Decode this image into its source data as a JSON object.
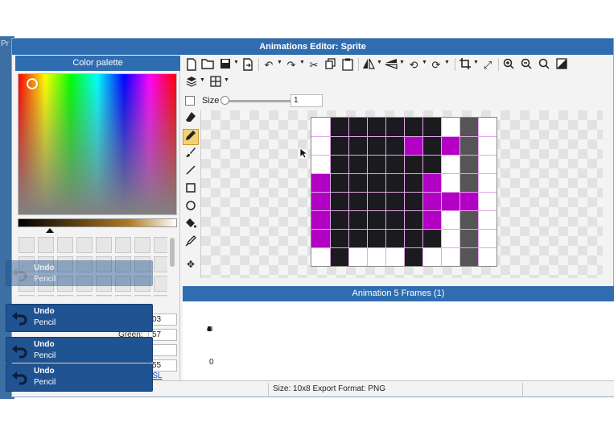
{
  "background_app": {
    "label": "Pr"
  },
  "window": {
    "title": "Animations Editor: Sprite"
  },
  "palette": {
    "title": "Color palette",
    "fields": {
      "r": "03",
      "g": "57",
      "b": "",
      "a": "55"
    },
    "green_label": "Green:",
    "mode_separator": "-",
    "mode_link": "HSL"
  },
  "toasts": [
    {
      "title": "Undo",
      "subtitle": "Pencil"
    },
    {
      "title": "Undo",
      "subtitle": "Pencil"
    },
    {
      "title": "Undo",
      "subtitle": "Pencil"
    },
    {
      "title": "Undo",
      "subtitle": "Pencil"
    }
  ],
  "toolbar": {
    "size_label": "Size",
    "size_value": "1"
  },
  "canvas": {
    "cols": 10,
    "rows": 8,
    "colors": {
      "K": "#1b1b1f",
      "M": "#b200c4",
      "G": "#555555",
      "W": ""
    },
    "pixels": [
      "WKKKKKKWGW",
      "WKKKKMKMGW",
      "WKKKKKKWGW",
      "MKKKKKMWGW",
      "MKKKKKMMMW",
      "MKKKKKMWGW",
      "MKKKKKKWGW",
      "WKWWWKWWGW"
    ]
  },
  "animation": {
    "title": "Animation 5 Frames (1)",
    "frame_index": "0"
  },
  "status": {
    "text": "Size: 10x8   Export Format: PNG"
  },
  "colors": {
    "accent": "#2f6db0",
    "toast": "#1f5391",
    "active_tool": "#f4d170"
  }
}
